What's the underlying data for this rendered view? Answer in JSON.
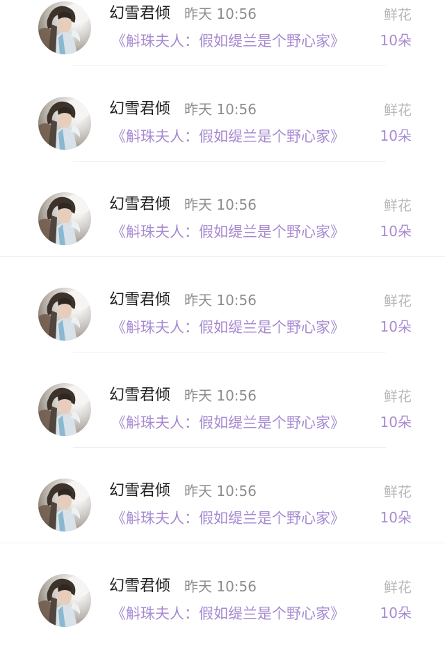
{
  "messages": [
    {
      "user_name": "幻雪君倾",
      "time": "昨天 10:56",
      "book_title": "《斛珠夫人：假如缇兰是个野心家》",
      "gift_type": "鲜花",
      "gift_count": "10朵"
    },
    {
      "user_name": "幻雪君倾",
      "time": "昨天 10:56",
      "book_title": "《斛珠夫人：假如缇兰是个野心家》",
      "gift_type": "鲜花",
      "gift_count": "10朵"
    },
    {
      "user_name": "幻雪君倾",
      "time": "昨天 10:56",
      "book_title": "《斛珠夫人：假如缇兰是个野心家》",
      "gift_type": "鲜花",
      "gift_count": "10朵"
    },
    {
      "user_name": "幻雪君倾",
      "time": "昨天 10:56",
      "book_title": "《斛珠夫人：假如缇兰是个野心家》",
      "gift_type": "鲜花",
      "gift_count": "10朵"
    },
    {
      "user_name": "幻雪君倾",
      "time": "昨天 10:56",
      "book_title": "《斛珠夫人：假如缇兰是个野心家》",
      "gift_type": "鲜花",
      "gift_count": "10朵"
    },
    {
      "user_name": "幻雪君倾",
      "time": "昨天 10:56",
      "book_title": "《斛珠夫人：假如缇兰是个野心家》",
      "gift_type": "鲜花",
      "gift_count": "10朵"
    },
    {
      "user_name": "幻雪君倾",
      "time": "昨天 10:56",
      "book_title": "《斛珠夫人：假如缇兰是个野心家》",
      "gift_type": "鲜花",
      "gift_count": "10朵"
    }
  ],
  "colors": {
    "name_text": "#202020",
    "time_text": "#8c8c8c",
    "accent_purple": "#a78bd2",
    "gift_label": "#b8b8b8",
    "divider": "#efefef",
    "background": "#ffffff"
  }
}
